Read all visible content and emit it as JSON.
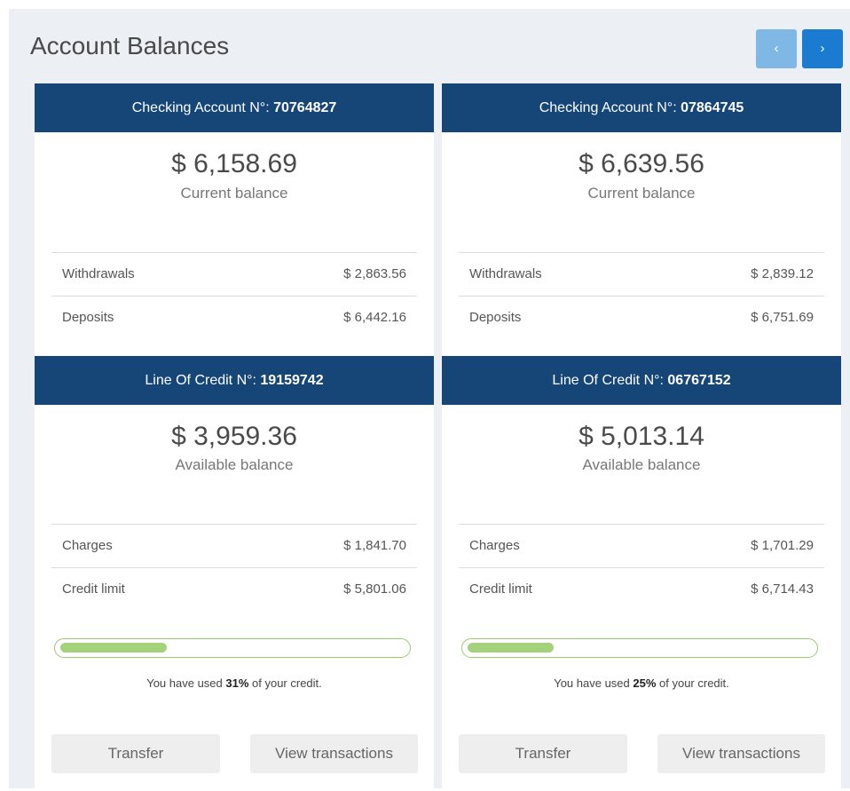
{
  "page": {
    "title": "Account Balances",
    "nav_prev": "‹",
    "nav_next": "›"
  },
  "columns": [
    {
      "checking": {
        "label": "Checking Account N°: ",
        "number": "70764827",
        "amount": "$ 6,158.69",
        "amount_label": "Current balance",
        "rows": [
          {
            "label": "Withdrawals",
            "value": "$ 2,863.56"
          },
          {
            "label": "Deposits",
            "value": "$ 6,442.16"
          }
        ]
      },
      "credit": {
        "label": "Line Of Credit N°: ",
        "number": "19159742",
        "amount": "$ 3,959.36",
        "amount_label": "Available balance",
        "rows": [
          {
            "label": "Charges",
            "value": "$ 1,841.70"
          },
          {
            "label": "Credit limit",
            "value": "$ 5,801.06"
          }
        ],
        "used_percent": 31,
        "usage_prefix": "You have used ",
        "usage_value": "31%",
        "usage_suffix": " of your credit."
      },
      "buttons": {
        "transfer": "Transfer",
        "view": "View transactions"
      }
    },
    {
      "checking": {
        "label": "Checking Account N°: ",
        "number": "07864745",
        "amount": "$ 6,639.56",
        "amount_label": "Current balance",
        "rows": [
          {
            "label": "Withdrawals",
            "value": "$ 2,839.12"
          },
          {
            "label": "Deposits",
            "value": "$ 6,751.69"
          }
        ]
      },
      "credit": {
        "label": "Line Of Credit N°: ",
        "number": "06767152",
        "amount": "$ 5,013.14",
        "amount_label": "Available balance",
        "rows": [
          {
            "label": "Charges",
            "value": "$ 1,701.29"
          },
          {
            "label": "Credit limit",
            "value": "$ 6,714.43"
          }
        ],
        "used_percent": 25,
        "usage_prefix": "You have used ",
        "usage_value": "25%",
        "usage_suffix": " of your credit."
      },
      "buttons": {
        "transfer": "Transfer",
        "view": "View transactions"
      }
    }
  ],
  "colors": {
    "header": "#154677",
    "nav_prev": "#7fb8e4",
    "nav_next": "#1a7bd1",
    "progress_fill": "#a3d27a",
    "progress_border": "#9bc96f",
    "panel_background": "#eceff4"
  }
}
